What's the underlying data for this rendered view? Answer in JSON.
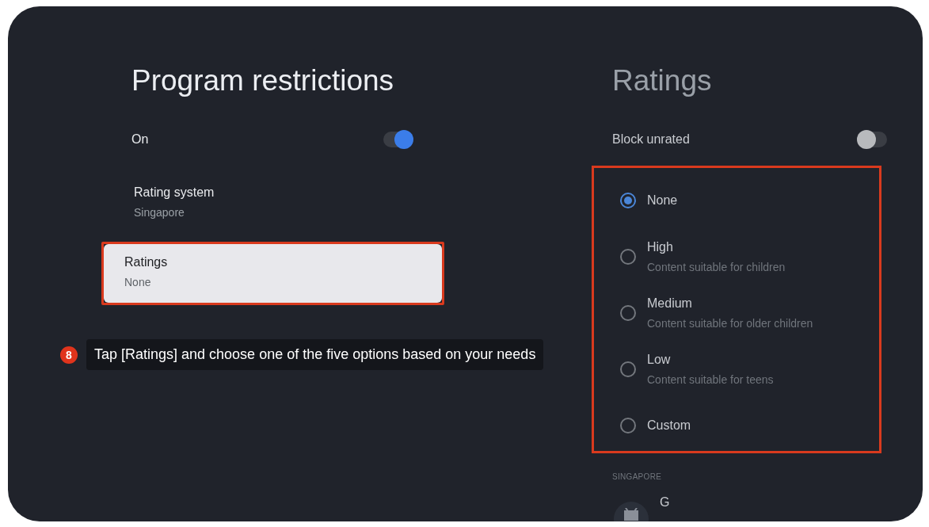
{
  "left": {
    "title": "Program restrictions",
    "items": [
      {
        "kind": "toggle",
        "label": "On",
        "on": true
      },
      {
        "kind": "item",
        "label": "Rating system",
        "value": "Singapore",
        "focused": false,
        "annotated": false
      },
      {
        "kind": "item",
        "label": "Ratings",
        "value": "None",
        "focused": true,
        "annotated": true
      }
    ]
  },
  "callout": {
    "step": "8",
    "text": "Tap [Ratings] and choose one of the five options based on your needs"
  },
  "right": {
    "title": "Ratings",
    "block_unrated": {
      "label": "Block unrated",
      "on": false
    },
    "options_annotated": true,
    "options": [
      {
        "label": "None",
        "selected": true
      },
      {
        "label": "High",
        "description": "Content suitable for children",
        "selected": false
      },
      {
        "label": "Medium",
        "description": "Content suitable for older children",
        "selected": false
      },
      {
        "label": "Low",
        "description": "Content suitable for teens",
        "selected": false
      },
      {
        "label": "Custom",
        "selected": false
      }
    ],
    "section": "SINGAPORE",
    "ratings": [
      {
        "label": "G"
      }
    ]
  }
}
